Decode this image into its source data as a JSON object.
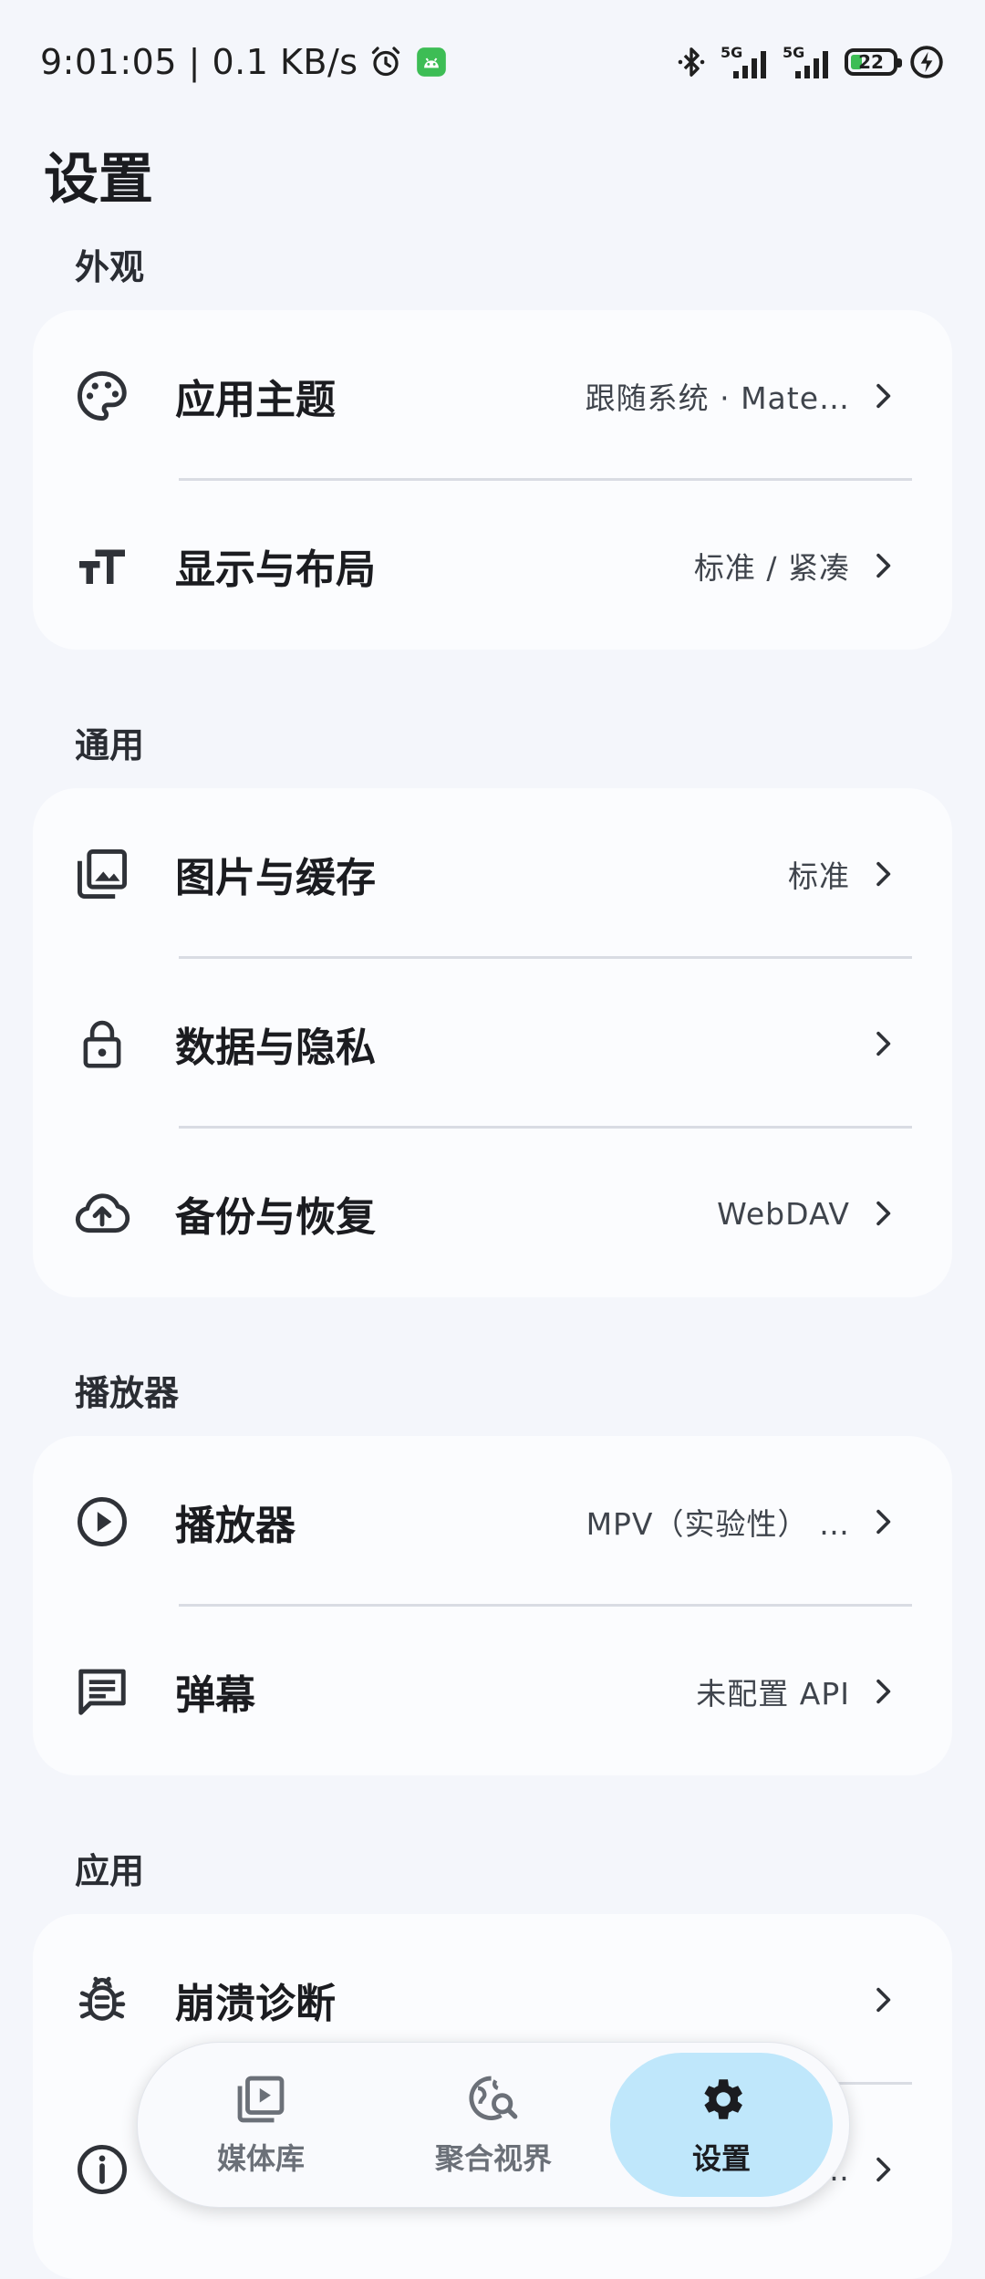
{
  "status_bar": {
    "time": "9:01:05 | 0.1 KB/s",
    "network_1": "5G",
    "network_2": "5G",
    "battery": "22"
  },
  "page": {
    "title": "设置"
  },
  "sections": {
    "appearance": {
      "title": "外观",
      "items": [
        {
          "label": "应用主题",
          "value": "跟随系统 · Mate…",
          "icon": "palette-icon"
        },
        {
          "label": "显示与布局",
          "value": "标准 / 紧凑",
          "icon": "text-size-icon"
        }
      ]
    },
    "general": {
      "title": "通用",
      "items": [
        {
          "label": "图片与缓存",
          "value": "标准",
          "icon": "photo-library-icon"
        },
        {
          "label": "数据与隐私",
          "value": "",
          "icon": "lock-icon"
        },
        {
          "label": "备份与恢复",
          "value": "WebDAV",
          "icon": "cloud-upload-icon"
        }
      ]
    },
    "player": {
      "title": "播放器",
      "items": [
        {
          "label": "播放器",
          "value": "MPV（实验性） …",
          "icon": "play-circle-icon"
        },
        {
          "label": "弹幕",
          "value": "未配置 API",
          "icon": "danmaku-icon"
        }
      ]
    },
    "app": {
      "title": "应用",
      "items": [
        {
          "label": "崩溃诊断",
          "value": "",
          "icon": "bug-icon"
        },
        {
          "label": "",
          "value": "…",
          "icon": "info-icon"
        }
      ]
    }
  },
  "nav": {
    "items": [
      {
        "label": "媒体库",
        "icon": "media-library-icon"
      },
      {
        "label": "聚合视界",
        "icon": "explore-search-icon"
      },
      {
        "label": "设置",
        "icon": "gear-icon"
      }
    ],
    "active_index": 2
  },
  "colors": {
    "background": "#f4f6fb",
    "card": "#fbfcfe",
    "nav_active": "#bfe7fb",
    "battery_fill": "#3dbd55"
  }
}
